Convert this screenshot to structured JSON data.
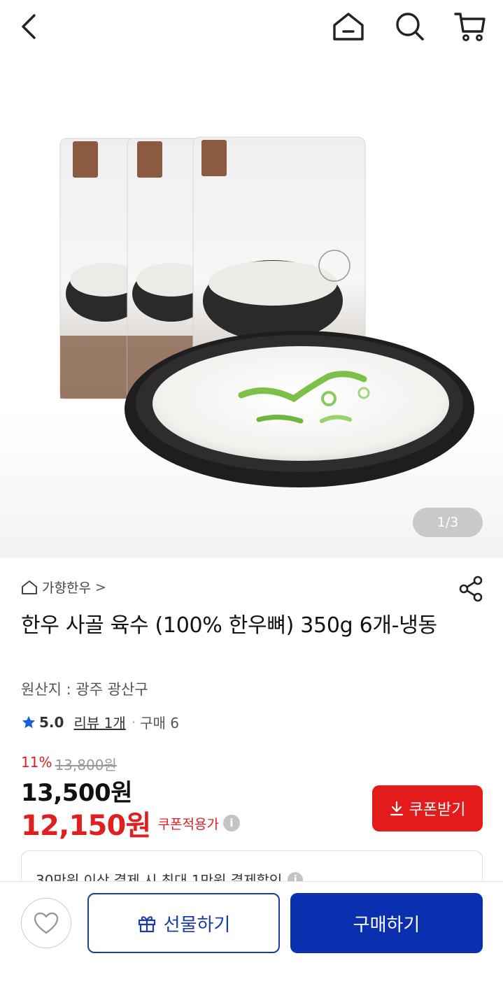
{
  "header": {
    "back_icon": "back-chevron-icon",
    "home_icon": "home-icon",
    "search_icon": "search-icon",
    "cart_icon": "cart-icon"
  },
  "hero": {
    "pager": "1/3",
    "image": "product-photo"
  },
  "product": {
    "shop_name": "가향한우",
    "shop_chevron": ">",
    "title": "한우 사골 육수 (100% 한우뼈) 350g  6개-냉동",
    "origin": "원산지 : 광주 광산구",
    "rating_score": "5.0",
    "review_link": "리뷰 1개",
    "dot": "·",
    "purchase_count": "구매 6",
    "discount_pct": "11%",
    "original_price": "13,800원",
    "price": "13,500원",
    "coupon_price": "12,150원",
    "coupon_price_label": "쿠폰적용가",
    "info_mark": "i",
    "coupon_button": "쿠폰받기",
    "promo_text": "30만원 이상 결제 시 최대 1만원 결제할인"
  },
  "bottom": {
    "gift_button": "선물하기",
    "buy_button": "구매하기"
  },
  "colors": {
    "accent_red": "#e02020",
    "coupon_button_bg": "#e31b1b",
    "primary_blue": "#0a30b0",
    "star": "#1a5fd6"
  }
}
